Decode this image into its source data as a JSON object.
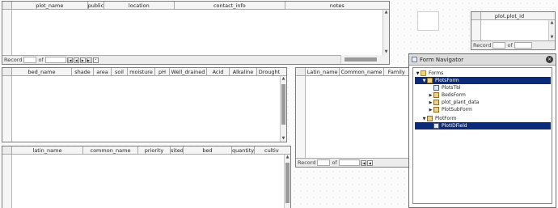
{
  "nav_labels": {
    "record": "Record",
    "of": "of"
  },
  "grid1": {
    "columns": [
      "plot_name",
      "public",
      "location",
      "contact_info",
      "notes"
    ]
  },
  "grid2": {
    "columns": [
      "bed_name",
      "shade",
      "area",
      "soil",
      "moisture",
      "pH",
      "Well_drained",
      "Acid",
      "Alkaline",
      "Drought"
    ]
  },
  "grid3": {
    "columns": [
      "latin_name",
      "common_name",
      "priority",
      "sited",
      "bed",
      "quantity",
      "cultiv"
    ]
  },
  "grid4": {
    "columns": [
      "Latin_name",
      "Common_name",
      "Family"
    ]
  },
  "plot_id_box": {
    "label": "plot.plot_id"
  },
  "navigator": {
    "title": "Form Navigator",
    "close": "×",
    "tree": {
      "forms": "Forms",
      "plotsform": "PlotsForm",
      "plotstbl": "PlotsTbl",
      "bedsform": "BedsForm",
      "plot_plant_data": "plot_plant_data",
      "plotsubform": "PlotSubForm",
      "plotform": "PlotForm",
      "plotidfield": "PlotIDField"
    }
  }
}
